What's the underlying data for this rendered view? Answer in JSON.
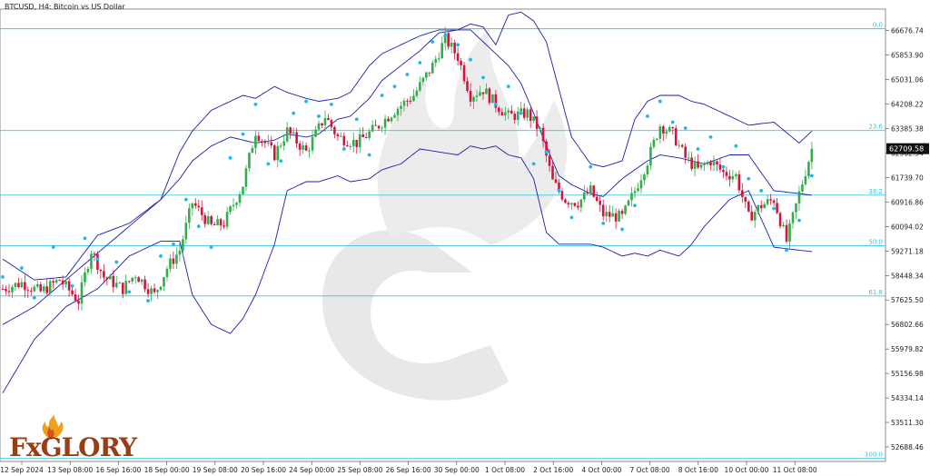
{
  "header": {
    "title": "BTCUSD, H4:  Bitcoin vs US Dollar"
  },
  "brand": {
    "logo_text": "FxGLORY"
  },
  "colors": {
    "bull": "#2fae4a",
    "bear": "#d6133f",
    "band": "#1a1fa8",
    "sar": "#1eb8e8",
    "fib": "#3cc3e0",
    "grid": "#e2e2e2",
    "axis": "#444444",
    "price_box": "#111111"
  },
  "chart_data": {
    "type": "candlestick",
    "title": "BTCUSD, H4:  Bitcoin vs US Dollar",
    "ylim": [
      52200,
      67400
    ],
    "y_ticks": [
      "66676.74",
      "65853.90",
      "65031.06",
      "64208.22",
      "63385.38",
      "62562.54",
      "61739.70",
      "60916.86",
      "60094.02",
      "59271.18",
      "58448.34",
      "57625.50",
      "56802.66",
      "55979.82",
      "55156.98",
      "54334.14",
      "53511.30",
      "52688.46"
    ],
    "x_ticks": [
      "12 Sep 2024",
      "13 Sep 08:00",
      "16 Sep 16:00",
      "18 Sep 00:00",
      "19 Sep 08:00",
      "20 Sep 16:00",
      "24 Sep 00:00",
      "25 Sep 08:00",
      "26 Sep 16:00",
      "30 Sep 00:00",
      "1 Oct 08:00",
      "2 Oct 16:00",
      "4 Oct 00:00",
      "7 Oct 08:00",
      "8 Oct 16:00",
      "10 Oct 00:00",
      "11 Oct 08:00"
    ],
    "current_price": "62709.58",
    "fib_levels": [
      {
        "label": "0.0",
        "price": 66740
      },
      {
        "label": "23.6",
        "price": 63320
      },
      {
        "label": "38.2",
        "price": 61150
      },
      {
        "label": "50.0",
        "price": 59450
      },
      {
        "label": "61.8",
        "price": 57760
      },
      {
        "label": "100.0",
        "price": 52300
      }
    ],
    "series": [
      {
        "kind": "ohlc",
        "anchors": [
          [
            0,
            58000
          ],
          [
            6,
            58200
          ],
          [
            12,
            57900
          ],
          [
            18,
            58300
          ],
          [
            24,
            57600
          ],
          [
            28,
            59300
          ],
          [
            32,
            58400
          ],
          [
            38,
            58000
          ],
          [
            42,
            58500
          ],
          [
            48,
            57800
          ],
          [
            52,
            58700
          ],
          [
            56,
            59300
          ],
          [
            60,
            60900
          ],
          [
            66,
            60100
          ],
          [
            70,
            60200
          ],
          [
            76,
            61500
          ],
          [
            80,
            63300
          ],
          [
            86,
            62500
          ],
          [
            90,
            63300
          ],
          [
            96,
            62600
          ],
          [
            102,
            63800
          ],
          [
            106,
            63100
          ],
          [
            112,
            62900
          ],
          [
            118,
            63400
          ],
          [
            124,
            64000
          ],
          [
            130,
            64500
          ],
          [
            136,
            65500
          ],
          [
            140,
            66400
          ],
          [
            144,
            65800
          ],
          [
            148,
            64500
          ],
          [
            152,
            64700
          ],
          [
            156,
            64200
          ],
          [
            160,
            63800
          ],
          [
            166,
            63900
          ],
          [
            170,
            63300
          ],
          [
            174,
            61600
          ],
          [
            178,
            61000
          ],
          [
            182,
            60900
          ],
          [
            186,
            61300
          ],
          [
            190,
            60500
          ],
          [
            196,
            60400
          ],
          [
            200,
            61300
          ],
          [
            204,
            62300
          ],
          [
            208,
            63500
          ],
          [
            212,
            63200
          ],
          [
            216,
            62400
          ],
          [
            220,
            62000
          ],
          [
            224,
            62300
          ],
          [
            228,
            61900
          ],
          [
            232,
            61800
          ],
          [
            236,
            60400
          ],
          [
            240,
            60800
          ],
          [
            244,
            61000
          ],
          [
            248,
            59600
          ],
          [
            252,
            61200
          ],
          [
            256,
            62700
          ]
        ]
      },
      {
        "kind": "band_upper",
        "anchors": [
          [
            0,
            59000
          ],
          [
            10,
            58300
          ],
          [
            20,
            58400
          ],
          [
            30,
            59800
          ],
          [
            40,
            60200
          ],
          [
            50,
            61000
          ],
          [
            56,
            62600
          ],
          [
            60,
            63300
          ],
          [
            66,
            64000
          ],
          [
            72,
            64300
          ],
          [
            76,
            64500
          ],
          [
            80,
            64400
          ],
          [
            86,
            64800
          ],
          [
            90,
            64600
          ],
          [
            96,
            64400
          ],
          [
            100,
            64300
          ],
          [
            106,
            64400
          ],
          [
            110,
            64600
          ],
          [
            116,
            65500
          ],
          [
            120,
            65900
          ],
          [
            126,
            66200
          ],
          [
            132,
            66500
          ],
          [
            138,
            66700
          ],
          [
            144,
            66700
          ],
          [
            148,
            66900
          ],
          [
            152,
            66800
          ],
          [
            156,
            66200
          ],
          [
            160,
            67200
          ],
          [
            164,
            67300
          ],
          [
            168,
            67000
          ],
          [
            172,
            66300
          ],
          [
            176,
            64700
          ],
          [
            180,
            63100
          ],
          [
            186,
            62200
          ],
          [
            190,
            62100
          ],
          [
            196,
            62300
          ],
          [
            200,
            63700
          ],
          [
            204,
            64300
          ],
          [
            208,
            64500
          ],
          [
            214,
            64500
          ],
          [
            218,
            64300
          ],
          [
            222,
            64200
          ],
          [
            230,
            63800
          ],
          [
            236,
            63500
          ],
          [
            244,
            63600
          ],
          [
            252,
            62900
          ],
          [
            256,
            63300
          ]
        ]
      },
      {
        "kind": "band_middle",
        "anchors": [
          [
            0,
            56800
          ],
          [
            10,
            57400
          ],
          [
            20,
            58300
          ],
          [
            30,
            59200
          ],
          [
            40,
            60100
          ],
          [
            50,
            61000
          ],
          [
            56,
            61700
          ],
          [
            60,
            62300
          ],
          [
            66,
            62800
          ],
          [
            72,
            63100
          ],
          [
            76,
            63000
          ],
          [
            80,
            62900
          ],
          [
            86,
            63000
          ],
          [
            90,
            63200
          ],
          [
            96,
            63100
          ],
          [
            100,
            63200
          ],
          [
            106,
            63700
          ],
          [
            110,
            63800
          ],
          [
            116,
            64400
          ],
          [
            120,
            65000
          ],
          [
            126,
            65500
          ],
          [
            132,
            66000
          ],
          [
            138,
            66600
          ],
          [
            144,
            66700
          ],
          [
            148,
            66700
          ],
          [
            152,
            66300
          ],
          [
            156,
            65900
          ],
          [
            160,
            65500
          ],
          [
            164,
            64900
          ],
          [
            168,
            63900
          ],
          [
            172,
            62800
          ],
          [
            176,
            61800
          ],
          [
            180,
            61500
          ],
          [
            186,
            61200
          ],
          [
            190,
            61100
          ],
          [
            196,
            61700
          ],
          [
            200,
            62000
          ],
          [
            204,
            62300
          ],
          [
            208,
            62500
          ],
          [
            214,
            62400
          ],
          [
            218,
            62300
          ],
          [
            222,
            62200
          ],
          [
            230,
            62500
          ],
          [
            236,
            62500
          ],
          [
            244,
            61300
          ],
          [
            252,
            61200
          ],
          [
            256,
            61150
          ]
        ]
      },
      {
        "kind": "band_lower",
        "anchors": [
          [
            0,
            54500
          ],
          [
            10,
            56300
          ],
          [
            20,
            57400
          ],
          [
            30,
            58000
          ],
          [
            40,
            59100
          ],
          [
            50,
            59600
          ],
          [
            56,
            59600
          ],
          [
            60,
            57800
          ],
          [
            66,
            56800
          ],
          [
            72,
            56500
          ],
          [
            76,
            57000
          ],
          [
            80,
            57800
          ],
          [
            86,
            59500
          ],
          [
            90,
            61300
          ],
          [
            96,
            61600
          ],
          [
            100,
            61600
          ],
          [
            106,
            61800
          ],
          [
            110,
            61600
          ],
          [
            116,
            61700
          ],
          [
            120,
            62000
          ],
          [
            126,
            62200
          ],
          [
            132,
            62700
          ],
          [
            138,
            62600
          ],
          [
            144,
            62500
          ],
          [
            148,
            62800
          ],
          [
            152,
            62700
          ],
          [
            156,
            62800
          ],
          [
            160,
            62500
          ],
          [
            164,
            62400
          ],
          [
            168,
            61700
          ],
          [
            172,
            59900
          ],
          [
            176,
            59500
          ],
          [
            180,
            59500
          ],
          [
            186,
            59500
          ],
          [
            190,
            59400
          ],
          [
            196,
            59100
          ],
          [
            200,
            59200
          ],
          [
            204,
            59100
          ],
          [
            208,
            59300
          ],
          [
            214,
            59100
          ],
          [
            218,
            59500
          ],
          [
            222,
            60100
          ],
          [
            230,
            61000
          ],
          [
            236,
            61300
          ],
          [
            244,
            59400
          ],
          [
            252,
            59300
          ],
          [
            256,
            59250
          ]
        ]
      },
      {
        "kind": "parabolic_sar",
        "anchors": [
          [
            0,
            58400
          ],
          [
            6,
            58700
          ],
          [
            10,
            57700
          ],
          [
            16,
            59400
          ],
          [
            22,
            58100
          ],
          [
            26,
            59700
          ],
          [
            30,
            59000
          ],
          [
            36,
            58900
          ],
          [
            40,
            57900
          ],
          [
            46,
            57600
          ],
          [
            50,
            59100
          ],
          [
            54,
            59500
          ],
          [
            58,
            61000
          ],
          [
            62,
            60100
          ],
          [
            66,
            59400
          ],
          [
            72,
            62400
          ],
          [
            76,
            63200
          ],
          [
            80,
            64200
          ],
          [
            84,
            62200
          ],
          [
            88,
            62300
          ],
          [
            92,
            63900
          ],
          [
            96,
            64300
          ],
          [
            100,
            63800
          ],
          [
            104,
            64200
          ],
          [
            108,
            62700
          ],
          [
            112,
            63700
          ],
          [
            116,
            62500
          ],
          [
            120,
            64500
          ],
          [
            124,
            64800
          ],
          [
            128,
            65200
          ],
          [
            132,
            65600
          ],
          [
            136,
            66300
          ],
          [
            140,
            66500
          ],
          [
            144,
            66200
          ],
          [
            148,
            65700
          ],
          [
            152,
            65100
          ],
          [
            156,
            64200
          ],
          [
            160,
            64800
          ],
          [
            164,
            63900
          ],
          [
            168,
            62200
          ],
          [
            172,
            62600
          ],
          [
            176,
            61300
          ],
          [
            180,
            60400
          ],
          [
            186,
            62100
          ],
          [
            190,
            60200
          ],
          [
            196,
            60000
          ],
          [
            200,
            60800
          ],
          [
            204,
            63800
          ],
          [
            208,
            64300
          ],
          [
            212,
            63600
          ],
          [
            216,
            63400
          ],
          [
            220,
            62700
          ],
          [
            224,
            63100
          ],
          [
            228,
            62100
          ],
          [
            232,
            62800
          ],
          [
            236,
            61700
          ],
          [
            240,
            61300
          ],
          [
            244,
            60700
          ],
          [
            248,
            59300
          ],
          [
            252,
            60300
          ],
          [
            256,
            61800
          ]
        ]
      }
    ]
  }
}
